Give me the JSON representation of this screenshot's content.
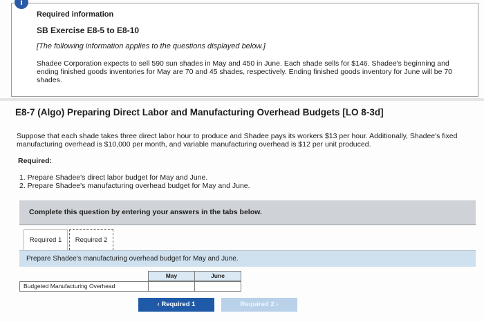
{
  "info": {
    "badge": "i",
    "title": "Required information",
    "exercise": "SB Exercise E8-5 to E8-10",
    "note": "[The following information applies to the questions displayed below.]",
    "body": "Shadee Corporation expects to sell 590 sun shades in May and 450 in June. Each shade sells for $146. Shadee's beginning and ending finished goods inventories for May are 70 and 45 shades, respectively. Ending finished goods inventory for June will be 70 shades."
  },
  "question": {
    "title": "E8-7 (Algo) Preparing Direct Labor and Manufacturing Overhead Budgets [LO 8-3d]",
    "body": "Suppose that each shade takes three direct labor hour to produce and Shadee pays its workers $13 per hour. Additionally, Shadee's fixed manufacturing overhead is $10,000 per month, and variable manufacturing overhead is $12 per unit produced.",
    "required_label": "Required:",
    "items": [
      "1. Prepare Shadee's direct labor budget for May and June.",
      "2. Prepare Shadee's manufacturing overhead budget for May and June."
    ]
  },
  "instructions": "Complete this question by entering your answers in the tabs below.",
  "tabs": [
    {
      "label": "Required 1"
    },
    {
      "label": "Required 2"
    }
  ],
  "panel_prompt": "Prepare Shadee's manufacturing overhead budget for May and June.",
  "table": {
    "columns": [
      "May",
      "June"
    ],
    "row_label": "Budgeted Manufacturing Overhead",
    "may_value": "",
    "june_value": ""
  },
  "nav": {
    "prev_label": "‹  Required 1",
    "next_label": "Required 2  ›"
  }
}
